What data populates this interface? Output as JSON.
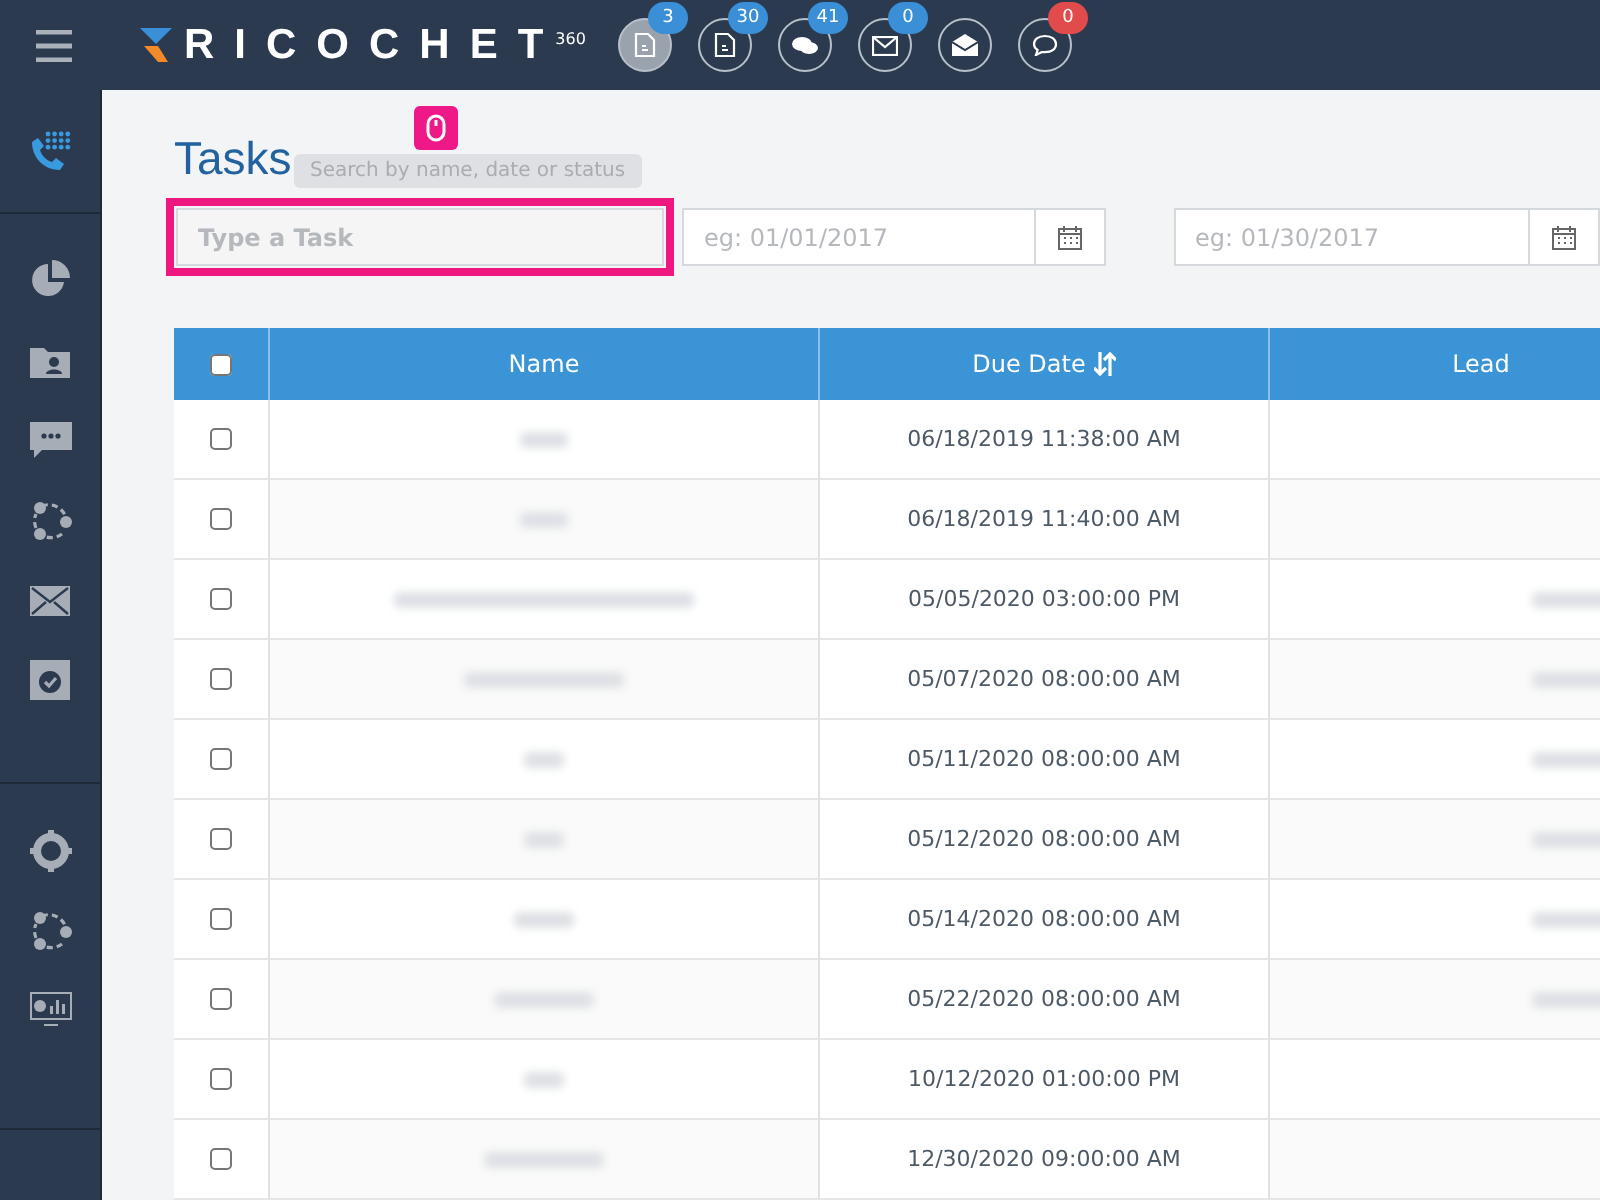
{
  "topbar": {
    "brand": "RICOCHET",
    "brand_sup": "360",
    "notifications": [
      {
        "count": "3",
        "color": "#3a8fd6",
        "active": true
      },
      {
        "count": "30",
        "color": "#3a8fd6",
        "active": false
      },
      {
        "count": "41",
        "color": "#3a8fd6",
        "active": false
      },
      {
        "count": "0",
        "color": "#3a8fd6",
        "active": false
      },
      {
        "active": false
      },
      {
        "count": "0",
        "color": "#e24b4b",
        "active": false
      }
    ]
  },
  "sidebar": {
    "top": {
      "selected": true
    },
    "items": [
      {
        "selected": false
      },
      {
        "selected": false
      },
      {
        "selected": false
      },
      {
        "selected": false
      },
      {
        "selected": false
      },
      {
        "selected": false
      },
      {
        "selected": false
      },
      {
        "selected": false
      },
      {
        "selected": false
      }
    ]
  },
  "page": {
    "title": "Tasks",
    "tooltip": "Search by name, date or status",
    "search": {
      "placeholder": "Type a Task",
      "highlighted": true
    },
    "date_from": {
      "placeholder": "eg: 01/01/2017"
    },
    "date_to": {
      "placeholder": "eg: 01/30/2017"
    }
  },
  "table": {
    "select_all": false,
    "columns": [
      {
        "label": "Name",
        "sortable": false
      },
      {
        "label": "Due Date",
        "sortable": true
      },
      {
        "label": "Lead",
        "sortable": false
      }
    ],
    "rows": [
      {
        "checked": false,
        "name_blurred": true,
        "due": "06/18/2019 11:38:00 AM",
        "lead_blurred": false
      },
      {
        "checked": false,
        "name_blurred": true,
        "due": "06/18/2019 11:40:00 AM",
        "lead_blurred": false
      },
      {
        "checked": false,
        "name_blurred": true,
        "due": "05/05/2020 03:00:00 PM",
        "lead_blurred": true
      },
      {
        "checked": false,
        "name_blurred": true,
        "due": "05/07/2020 08:00:00 AM",
        "lead_blurred": true
      },
      {
        "checked": false,
        "name_blurred": true,
        "due": "05/11/2020 08:00:00 AM",
        "lead_blurred": true
      },
      {
        "checked": false,
        "name_blurred": true,
        "due": "05/12/2020 08:00:00 AM",
        "lead_blurred": true
      },
      {
        "checked": false,
        "name_blurred": true,
        "due": "05/14/2020 08:00:00 AM",
        "lead_blurred": true
      },
      {
        "checked": false,
        "name_blurred": true,
        "due": "05/22/2020 08:00:00 AM",
        "lead_blurred": true
      },
      {
        "checked": false,
        "name_blurred": true,
        "due": "10/12/2020 01:00:00 PM",
        "lead_blurred": false
      },
      {
        "checked": false,
        "name_blurred": true,
        "due": "12/30/2020 09:00:00 AM",
        "lead_blurred": false
      }
    ]
  }
}
